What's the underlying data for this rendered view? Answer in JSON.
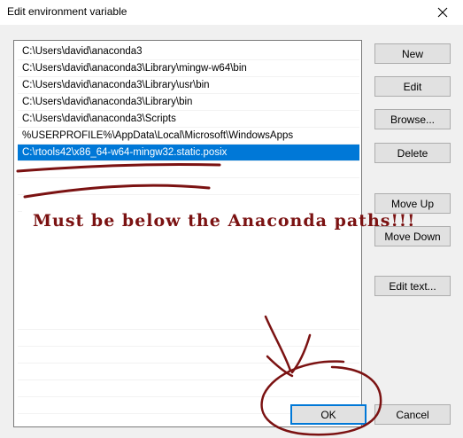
{
  "window": {
    "title": "Edit environment variable",
    "close_icon": "close-icon"
  },
  "paths": {
    "items": [
      "C:\\Users\\david\\anaconda3",
      "C:\\Users\\david\\anaconda3\\Library\\mingw-w64\\bin",
      "C:\\Users\\david\\anaconda3\\Library\\usr\\bin",
      "C:\\Users\\david\\anaconda3\\Library\\bin",
      "C:\\Users\\david\\anaconda3\\Scripts",
      "%USERPROFILE%\\AppData\\Local\\Microsoft\\WindowsApps",
      "C:\\rtools42\\x86_64-w64-mingw32.static.posix"
    ],
    "selected_index": 6
  },
  "buttons": {
    "new": "New",
    "edit": "Edit",
    "browse": "Browse...",
    "delete": "Delete",
    "move_up": "Move Up",
    "move_down": "Move Down",
    "edit_text": "Edit text...",
    "ok": "OK",
    "cancel": "Cancel"
  },
  "annotation": {
    "text": "Must be below the Anaconda paths!!!",
    "color": "#7b1212"
  },
  "colors": {
    "selection": "#0078d7",
    "background": "#f0f0f0"
  }
}
